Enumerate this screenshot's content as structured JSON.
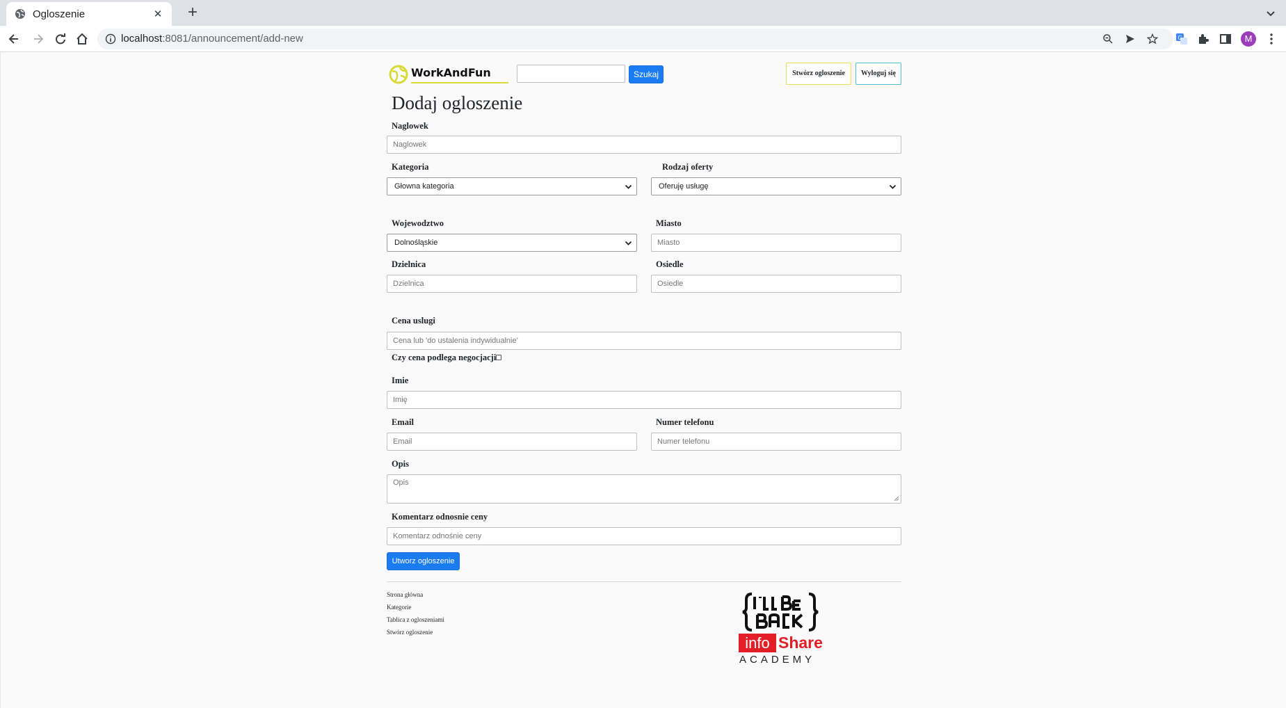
{
  "browser": {
    "tab_title": "Ogloszenie",
    "url_host": "localhost",
    "url_rest": ":8081/announcement/add-new",
    "profile_initial": "M"
  },
  "header": {
    "logo_text": "WorkAndFun",
    "search_value": "",
    "search_button": "Szukaj",
    "create_button": "Stwórz ogloszenie",
    "logout_button": "Wyloguj się"
  },
  "form": {
    "title": "Dodaj ogloszenie",
    "naglowek": {
      "label": "Naglowek",
      "placeholder": "Naglowek"
    },
    "kategoria": {
      "label": "Kategoria",
      "selected": "Głowna kategoria"
    },
    "rodzaj": {
      "label": "Rodzaj oferty",
      "selected": "Oferuję usługę"
    },
    "wojewodztwo": {
      "label": "Wojewodztwo",
      "selected": "Dolnośląskie"
    },
    "miasto": {
      "label": "Miasto",
      "placeholder": "Miasto"
    },
    "dzielnica": {
      "label": "Dzielnica",
      "placeholder": "Dzielnica"
    },
    "osiedle": {
      "label": "Osiedle",
      "placeholder": "Osiedle"
    },
    "cena": {
      "label": "Cena uslugi",
      "placeholder": "Cena lub 'do ustalenia indywidualnie'"
    },
    "negocjacja": {
      "label": "Czy cena podlega negocjacji",
      "checked": false
    },
    "imie": {
      "label": "Imie",
      "placeholder": "Imię"
    },
    "email": {
      "label": "Email",
      "placeholder": "Email"
    },
    "telefon": {
      "label": "Numer telefonu",
      "placeholder": "Numer telefonu"
    },
    "opis": {
      "label": "Opis",
      "placeholder": "Opis"
    },
    "komentarz": {
      "label": "Komentarz odnosnie ceny",
      "placeholder": "Komentarz odnośnie ceny"
    },
    "submit": "Utworz ogloszenie"
  },
  "footer": {
    "links": [
      "Strona główna",
      "Kategorie",
      "Tablica z ogloszeniami",
      "Stwórz ogloszenie"
    ],
    "brand_info": "info",
    "brand_share": "Share",
    "brand_academy": "ACADEMY"
  },
  "colors": {
    "primary_button": "#1b7cf2",
    "create_border": "#ece050",
    "logout_border": "#4fbfd6",
    "infoshare_red": "#e21f26"
  }
}
